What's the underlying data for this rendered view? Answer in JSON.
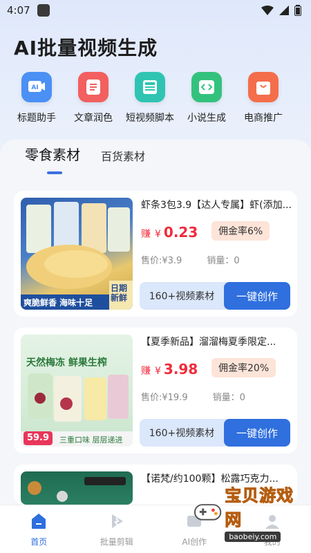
{
  "status": {
    "time": "4:07"
  },
  "title": "AI批量视频生成",
  "tools": [
    {
      "label": "标题助手",
      "icon": "ai-badge-icon",
      "color": "#3f8cf0"
    },
    {
      "label": "文章润色",
      "icon": "document-icon",
      "color": "#f25a5a"
    },
    {
      "label": "短视频脚本",
      "icon": "script-icon",
      "color": "#2fbfae"
    },
    {
      "label": "小说生成",
      "icon": "code-icon",
      "color": "#2fbf7a"
    },
    {
      "label": "电商推广",
      "icon": "shopping-bag-icon",
      "color": "#f26a46"
    }
  ],
  "tabs": [
    {
      "label": "零食素材",
      "active": true
    },
    {
      "label": "百货素材",
      "active": false
    }
  ],
  "products": [
    {
      "title": "虾条3包3.9【达人专属】虾(添加...",
      "earn_prefix": "赚",
      "yen": "¥",
      "earn_amount": "0.23",
      "commission": "佣金率6%",
      "price": "售价:¥3.9",
      "sales": "销量：0",
      "assets_label": "160+视频素材",
      "create_label": "一键创作",
      "image_caption_left": "爽脆鲜香 海味十足",
      "image_caption_right": "日期新鲜"
    },
    {
      "title": "【夏季新品】溜溜梅夏季限定...",
      "earn_prefix": "赚",
      "yen": "¥",
      "earn_amount": "3.98",
      "commission": "佣金率20%",
      "price": "售价:¥19.9",
      "sales": "销量：0",
      "assets_label": "160+视频素材",
      "create_label": "一键创作",
      "image_caption_top": "天然梅冻 鲜果生榨",
      "image_caption_bottom": "三重口味 层层递进",
      "image_price": "59.9"
    },
    {
      "title": "【诺梵/约100颗】松露巧克力..."
    }
  ],
  "nav": [
    {
      "label": "首页",
      "icon": "home-icon",
      "active": true
    },
    {
      "label": "批量剪辑",
      "icon": "play-icon",
      "active": false
    },
    {
      "label": "AI创作",
      "icon": "ai-create-icon",
      "active": false
    },
    {
      "label": "我的",
      "icon": "profile-icon",
      "active": false
    }
  ],
  "watermark": {
    "text": "宝贝游戏网",
    "url": "baobeiy.com"
  }
}
